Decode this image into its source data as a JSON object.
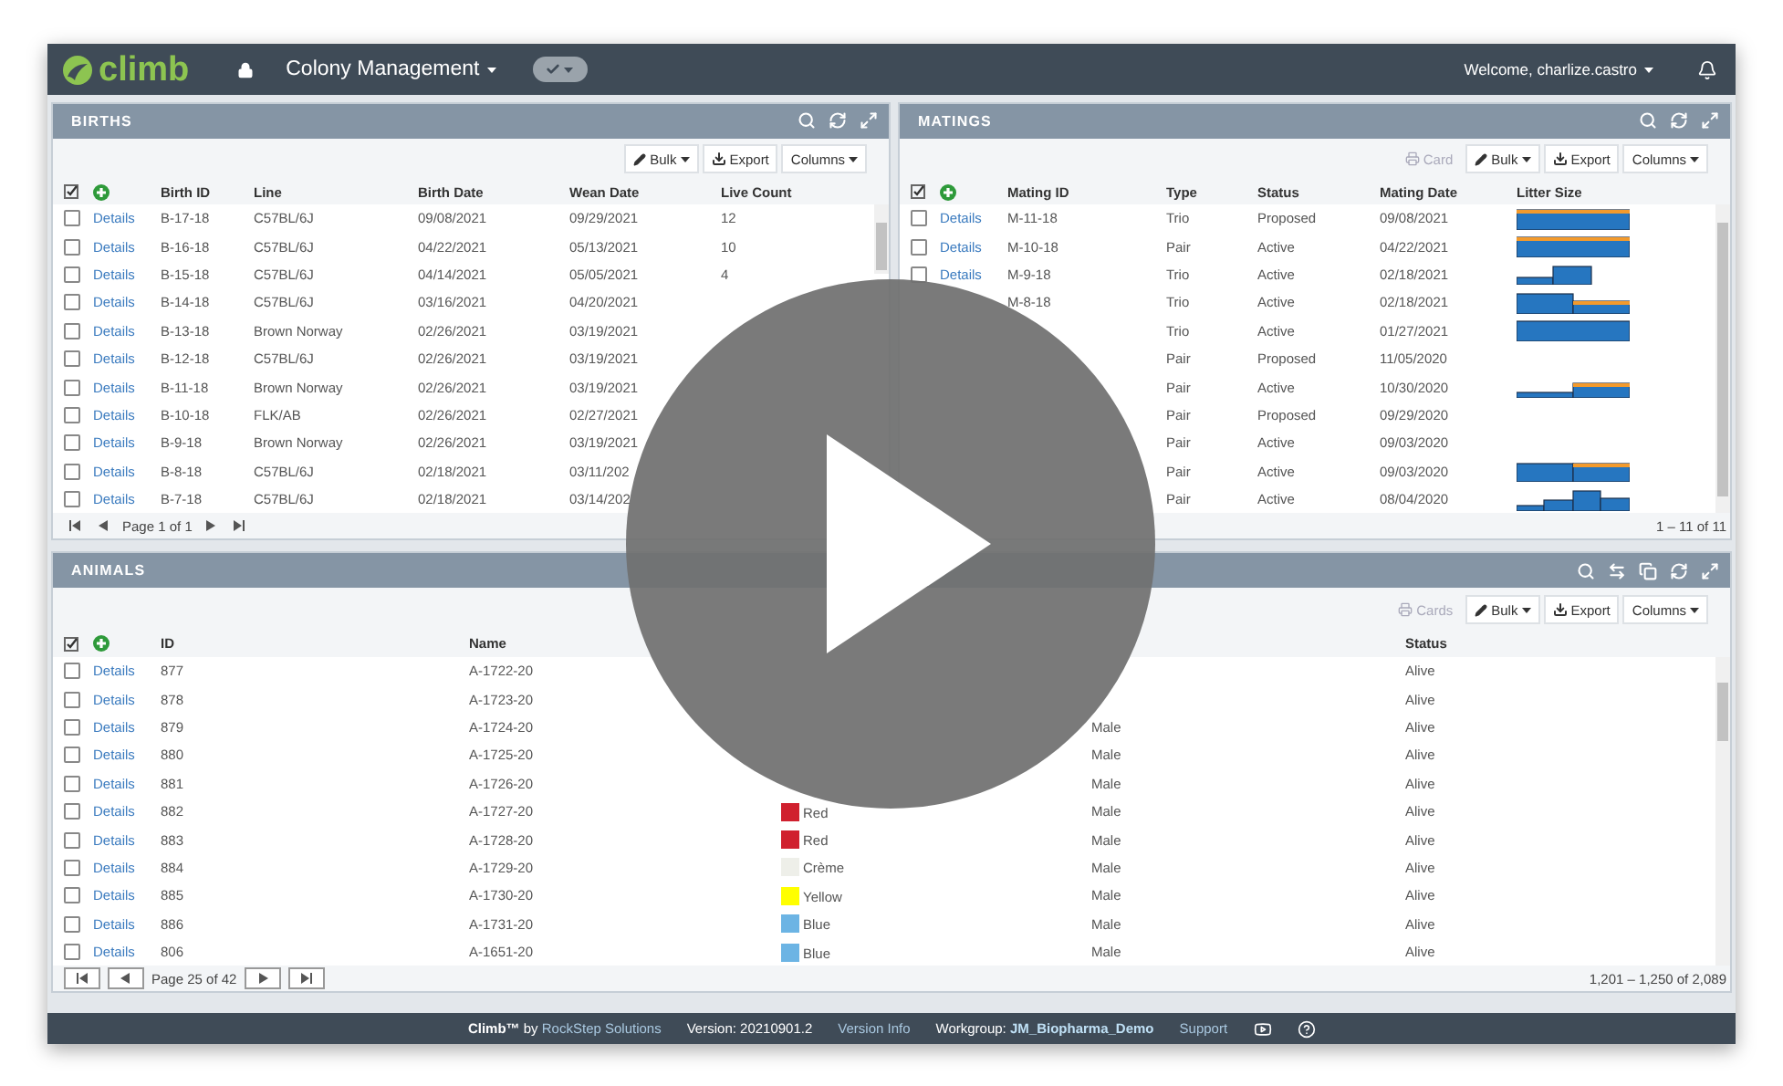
{
  "header": {
    "logo": "climb",
    "module": "Colony Management",
    "toggle_on": true,
    "user": "Welcome, charlize.castro"
  },
  "births": {
    "title": "BIRTHS",
    "toolbar": [
      {
        "kind": "bulk",
        "label": "Bulk",
        "disabled": false
      },
      {
        "kind": "export",
        "label": "Export",
        "disabled": false
      },
      {
        "kind": "columns",
        "label": "Columns",
        "disabled": false
      }
    ],
    "columns": [
      "Birth ID",
      "Line",
      "Birth Date",
      "Wean Date",
      "Live Count"
    ],
    "rows": [
      {
        "checked": false,
        "details": "Details",
        "id": "B-17-18",
        "line": "C57BL/6J",
        "birth_date": "09/08/2021",
        "wean_date": "09/29/2021",
        "live_count": "12"
      },
      {
        "checked": false,
        "details": "Details",
        "id": "B-16-18",
        "line": "C57BL/6J",
        "birth_date": "04/22/2021",
        "wean_date": "05/13/2021",
        "live_count": "10"
      },
      {
        "checked": false,
        "details": "Details",
        "id": "B-15-18",
        "line": "C57BL/6J",
        "birth_date": "04/14/2021",
        "wean_date": "05/05/2021",
        "live_count": "4"
      },
      {
        "checked": false,
        "details": "Details",
        "id": "B-14-18",
        "line": "C57BL/6J",
        "birth_date": "03/16/2021",
        "wean_date": "04/20/2021"
      },
      {
        "checked": false,
        "details": "Details",
        "id": "B-13-18",
        "line": "Brown Norway",
        "birth_date": "02/26/2021",
        "wean_date": "03/19/2021"
      },
      {
        "checked": false,
        "details": "Details",
        "id": "B-12-18",
        "line": "C57BL/6J",
        "birth_date": "02/26/2021",
        "wean_date": "03/19/2021"
      },
      {
        "checked": false,
        "details": "Details",
        "id": "B-11-18",
        "line": "Brown Norway",
        "birth_date": "02/26/2021",
        "wean_date": "03/19/2021"
      },
      {
        "checked": false,
        "details": "Details",
        "id": "B-10-18",
        "line": "FLK/AB",
        "birth_date": "02/26/2021",
        "wean_date": "02/27/2021"
      },
      {
        "checked": false,
        "details": "Details",
        "id": "B-9-18",
        "line": "Brown Norway",
        "birth_date": "02/26/2021",
        "wean_date": "03/19/2021"
      },
      {
        "checked": false,
        "details": "Details",
        "id": "B-8-18",
        "line": "C57BL/6J",
        "birth_date": "02/18/2021",
        "wean_date": "03/11/202"
      },
      {
        "checked": false,
        "details": "Details",
        "id": "B-7-18",
        "line": "C57BL/6J",
        "birth_date": "02/18/2021",
        "wean_date": "03/14/202"
      }
    ],
    "pager": {
      "kind": "plain",
      "page": "Page 1 of 1"
    }
  },
  "matings": {
    "title": "MATINGS",
    "toolbar": [
      {
        "kind": "print",
        "label": "Card",
        "disabled": true
      },
      {
        "kind": "bulk",
        "label": "Bulk",
        "disabled": false
      },
      {
        "kind": "export",
        "label": "Export",
        "disabled": false
      },
      {
        "kind": "columns",
        "label": "Columns",
        "disabled": false
      }
    ],
    "columns": [
      "Mating ID",
      "Type",
      "Status",
      "Mating Date",
      "Litter Size"
    ],
    "rows": [
      {
        "checked": false,
        "details": "Details",
        "id": "M-11-18",
        "type": "Trio",
        "status": "Proposed",
        "date": "09/08/2021"
      },
      {
        "checked": false,
        "details": "Details",
        "id": "M-10-18",
        "type": "Pair",
        "status": "Active",
        "date": "04/22/2021"
      },
      {
        "checked": false,
        "details": "Details",
        "id": "M-9-18",
        "type": "Trio",
        "status": "Active",
        "date": "02/18/2021"
      },
      {
        "id": "M-8-18",
        "type": "Trio",
        "status": "Active",
        "date": "02/18/2021"
      },
      {
        "type": "Trio",
        "status": "Active",
        "date": "01/27/2021"
      },
      {
        "type": "Pair",
        "status": "Proposed",
        "date": "11/05/2020"
      },
      {
        "type": "Pair",
        "status": "Active",
        "date": "10/30/2020"
      },
      {
        "type": "Pair",
        "status": "Proposed",
        "date": "09/29/2020"
      },
      {
        "type": "Pair",
        "status": "Active",
        "date": "09/03/2020"
      },
      {
        "type": "Pair",
        "status": "Active",
        "date": "09/03/2020"
      },
      {
        "type": "Pair",
        "status": "Active",
        "date": "08/04/2020"
      }
    ],
    "pager": {
      "count": "1 – 11 of 11"
    }
  },
  "animals": {
    "title": "ANIMALS",
    "toolbar": [
      {
        "kind": "print",
        "label": "Cards",
        "disabled": true
      },
      {
        "kind": "bulk",
        "label": "Bulk",
        "disabled": false
      },
      {
        "kind": "export",
        "label": "Export",
        "disabled": false
      },
      {
        "kind": "columns",
        "label": "Columns",
        "disabled": false
      }
    ],
    "columns": [
      "ID",
      "Name",
      "Status"
    ],
    "rows": [
      {
        "checked": false,
        "details": "Details",
        "id": "877",
        "name": "A-1722-20",
        "status": "Alive"
      },
      {
        "checked": false,
        "details": "Details",
        "id": "878",
        "name": "A-1723-20",
        "status": "Alive"
      },
      {
        "checked": false,
        "details": "Details",
        "id": "879",
        "name": "A-1724-20",
        "sex": "Male",
        "status": "Alive"
      },
      {
        "checked": false,
        "details": "Details",
        "id": "880",
        "name": "A-1725-20",
        "sex": "Male",
        "status": "Alive"
      },
      {
        "checked": false,
        "details": "Details",
        "id": "881",
        "name": "A-1726-20",
        "sex": "Male",
        "status": "Alive"
      },
      {
        "checked": false,
        "details": "Details",
        "id": "882",
        "name": "A-1727-20",
        "marking": {
          "label": "Red",
          "color": "#d0202e"
        },
        "sex": "Male",
        "status": "Alive"
      },
      {
        "checked": false,
        "details": "Details",
        "id": "883",
        "name": "A-1728-20",
        "marking": {
          "label": "Red",
          "color": "#d0202e"
        },
        "sex": "Male",
        "status": "Alive"
      },
      {
        "checked": false,
        "details": "Details",
        "id": "884",
        "name": "A-1729-20",
        "marking": {
          "label": "Crème",
          "color": "#eeefe9"
        },
        "sex": "Male",
        "status": "Alive"
      },
      {
        "checked": false,
        "details": "Details",
        "id": "885",
        "name": "A-1730-20",
        "marking": {
          "label": "Yellow",
          "color": "#ffff00"
        },
        "sex": "Male",
        "status": "Alive"
      },
      {
        "checked": false,
        "details": "Details",
        "id": "886",
        "name": "A-1731-20",
        "marking": {
          "label": "Blue",
          "color": "#6cb4e4"
        },
        "sex": "Male",
        "status": "Alive"
      },
      {
        "checked": false,
        "details": "Details",
        "id": "806",
        "name": "A-1651-20",
        "marking": {
          "label": "Blue",
          "color": "#6cb4e4"
        },
        "sex": "Male",
        "status": "Alive"
      }
    ],
    "pager": {
      "kind": "boxed",
      "page": "Page 25 of 42",
      "count": "1,201 – 1,250 of 2,089"
    }
  },
  "footer": {
    "credit": "**Climb™** by",
    "company": "RockStep Solutions",
    "version": "Version: 20210901.2",
    "version_info": "Version Info",
    "workgroup": "Workgroup: **JM_Biopharma_Demo**",
    "support": "Support"
  }
}
